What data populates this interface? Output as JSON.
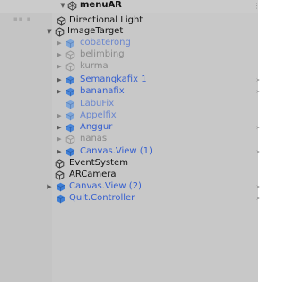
{
  "colors": {
    "panel_bg": "#c8c8c8",
    "prefab_blue": "#345ecf",
    "inactive_gray": "#888888",
    "text": "#101010"
  },
  "hierarchy": {
    "scene": {
      "label": "menuAR",
      "icon": "unity-scene-icon",
      "menu_icon": "more-vertical-icon"
    },
    "items": [
      {
        "label": "Directional Light",
        "icon": "gameobject-icon"
      },
      {
        "label": "ImageTarget",
        "icon": "gameobject-icon"
      },
      {
        "label": "cobaterong",
        "icon": "prefab-icon"
      },
      {
        "label": "belimbing",
        "icon": "gameobject-icon"
      },
      {
        "label": "kurma",
        "icon": "gameobject-icon"
      },
      {
        "label": "Semangkafix 1",
        "icon": "prefab-icon"
      },
      {
        "label": "bananafix",
        "icon": "prefab-icon"
      },
      {
        "label": "LabuFix",
        "icon": "prefab-icon"
      },
      {
        "label": "Appelfix",
        "icon": "prefab-icon"
      },
      {
        "label": "Anggur",
        "icon": "prefab-icon"
      },
      {
        "label": "nanas",
        "icon": "gameobject-icon"
      },
      {
        "label": "Canvas.View (1)",
        "icon": "prefab-icon"
      },
      {
        "label": "EventSystem",
        "icon": "gameobject-icon"
      },
      {
        "label": "ARCamera",
        "icon": "gameobject-icon"
      },
      {
        "label": "Canvas.View (2)",
        "icon": "prefab-icon"
      },
      {
        "label": "Quit.Controller",
        "icon": "prefab-icon"
      }
    ]
  }
}
